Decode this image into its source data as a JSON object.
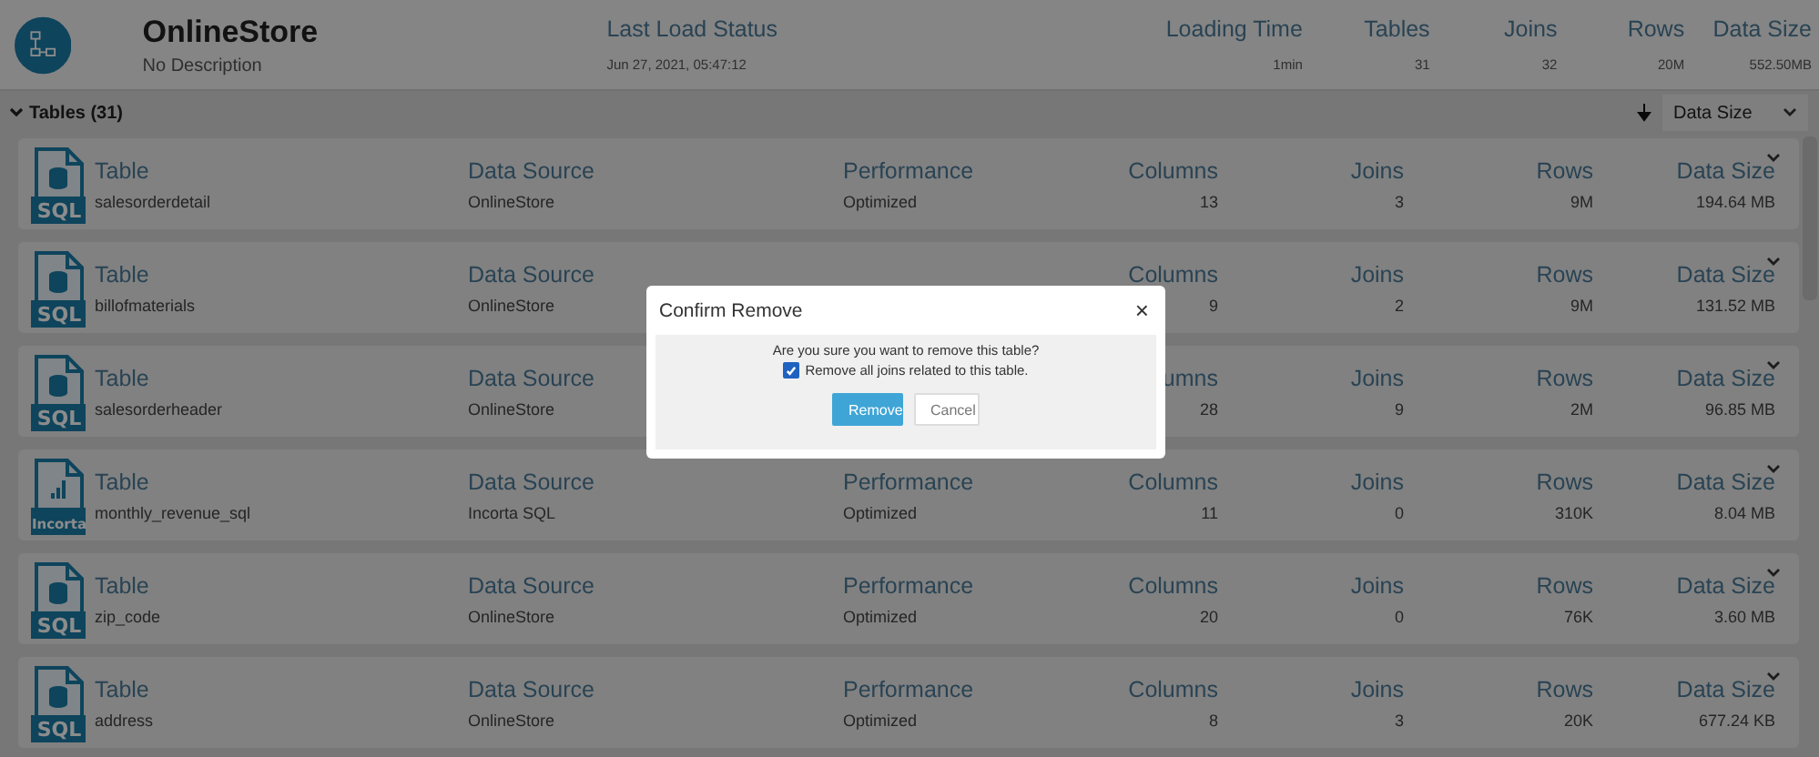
{
  "schema": {
    "name": "OnlineStore",
    "description": "No Description",
    "stats": [
      {
        "label": "Last Load Status",
        "value": "Jun 27, 2021, 05:47:12",
        "kind": "wide"
      },
      {
        "label": "Loading Time",
        "value": "1min",
        "kind": "num"
      },
      {
        "label": "Tables",
        "value": "31",
        "kind": "num"
      },
      {
        "label": "Joins",
        "value": "32",
        "kind": "num"
      },
      {
        "label": "Rows",
        "value": "20M",
        "kind": "num"
      },
      {
        "label": "Data Size",
        "value": "552.50MB",
        "kind": "num"
      }
    ]
  },
  "tables_section": {
    "title": "Tables (31)",
    "expanded": true,
    "sort": {
      "value": "Data Size"
    }
  },
  "rows": [
    {
      "kind": "sql",
      "icon_label": "SQL",
      "cells": [
        {
          "label": "Table",
          "value": "salesorderdetail"
        },
        {
          "label": "Data Source",
          "value": "OnlineStore"
        },
        {
          "label": "Performance",
          "value": "Optimized"
        },
        {
          "label": "Columns",
          "value": "13"
        },
        {
          "label": "Joins",
          "value": "3"
        },
        {
          "label": "Rows",
          "value": "9M"
        },
        {
          "label": "Data Size",
          "value": "194.64 MB"
        }
      ]
    },
    {
      "kind": "sql",
      "icon_label": "SQL",
      "cells": [
        {
          "label": "Table",
          "value": "billofmaterials"
        },
        {
          "label": "Data Source",
          "value": "OnlineStore"
        },
        {},
        {
          "label": "Columns",
          "value": "9"
        },
        {
          "label": "Joins",
          "value": "2"
        },
        {
          "label": "Rows",
          "value": "9M"
        },
        {
          "label": "Data Size",
          "value": "131.52 MB"
        }
      ]
    },
    {
      "kind": "sql",
      "icon_label": "SQL",
      "cells": [
        {
          "label": "Table",
          "value": "salesorderheader"
        },
        {
          "label": "Data Source",
          "value": "OnlineStore"
        },
        {},
        {
          "label": "umns",
          "value": "28"
        },
        {
          "label": "Joins",
          "value": "9"
        },
        {
          "label": "Rows",
          "value": "2M"
        },
        {
          "label": "Data Size",
          "value": "96.85 MB"
        }
      ]
    },
    {
      "kind": "incorta",
      "icon_label": "Incorta",
      "cells": [
        {
          "label": "Table",
          "value": "monthly_revenue_sql"
        },
        {
          "label": "Data Source",
          "value": "Incorta SQL"
        },
        {
          "label": "Performance",
          "value": "Optimized"
        },
        {
          "label": "Columns",
          "value": "11"
        },
        {
          "label": "Joins",
          "value": "0"
        },
        {
          "label": "Rows",
          "value": "310K"
        },
        {
          "label": "Data Size",
          "value": "8.04 MB"
        }
      ]
    },
    {
      "kind": "sql",
      "icon_label": "SQL",
      "cells": [
        {
          "label": "Table",
          "value": "zip_code"
        },
        {
          "label": "Data Source",
          "value": "OnlineStore"
        },
        {
          "label": "Performance",
          "value": "Optimized"
        },
        {
          "label": "Columns",
          "value": "20"
        },
        {
          "label": "Joins",
          "value": "0"
        },
        {
          "label": "Rows",
          "value": "76K"
        },
        {
          "label": "Data Size",
          "value": "3.60 MB"
        }
      ]
    },
    {
      "kind": "sql",
      "icon_label": "SQL",
      "cells": [
        {
          "label": "Table",
          "value": "address"
        },
        {
          "label": "Data Source",
          "value": "OnlineStore"
        },
        {
          "label": "Performance",
          "value": "Optimized"
        },
        {
          "label": "Columns",
          "value": "8"
        },
        {
          "label": "Joins",
          "value": "3"
        },
        {
          "label": "Rows",
          "value": "20K"
        },
        {
          "label": "Data Size",
          "value": "677.24 KB"
        }
      ]
    }
  ],
  "dialog": {
    "title": "Confirm Remove",
    "close": "×",
    "message": "Are you sure you want to remove this table?",
    "checkbox": {
      "label": "Remove all joins related to this table.",
      "checked": true
    },
    "buttons": [
      {
        "label": "Remove",
        "kind": "primary"
      },
      {
        "label": "Cancel",
        "kind": "default"
      }
    ]
  }
}
